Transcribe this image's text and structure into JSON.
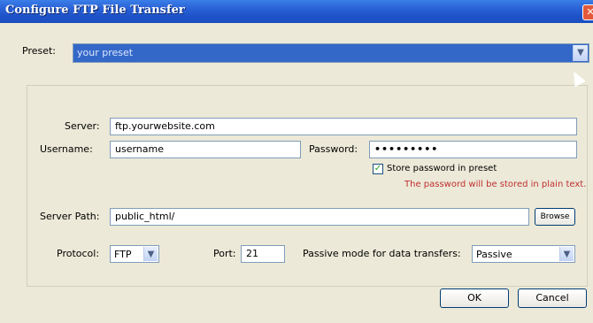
{
  "window": {
    "title": "Configure FTP File Transfer",
    "close_glyph": "✕"
  },
  "preset": {
    "label": "Preset:",
    "value": "your preset",
    "dropdown_icon": "chevron-down-icon"
  },
  "server": {
    "label": "Server:",
    "value": "ftp.yourwebsite.com"
  },
  "username": {
    "label": "Username:",
    "value": "username"
  },
  "password": {
    "label": "Password:",
    "value": "•••••••••"
  },
  "store_password": {
    "label": "Store password in preset",
    "checked": true,
    "note": "The password will be stored in plain text."
  },
  "server_path": {
    "label": "Server Path:",
    "value": "public_html/",
    "browse_label": "Browse"
  },
  "protocol": {
    "label": "Protocol:",
    "value": "FTP"
  },
  "port": {
    "label": "Port:",
    "value": "21"
  },
  "passive": {
    "label": "Passive mode for data transfers:",
    "value": "Passive"
  },
  "buttons": {
    "ok": "OK",
    "cancel": "Cancel"
  }
}
